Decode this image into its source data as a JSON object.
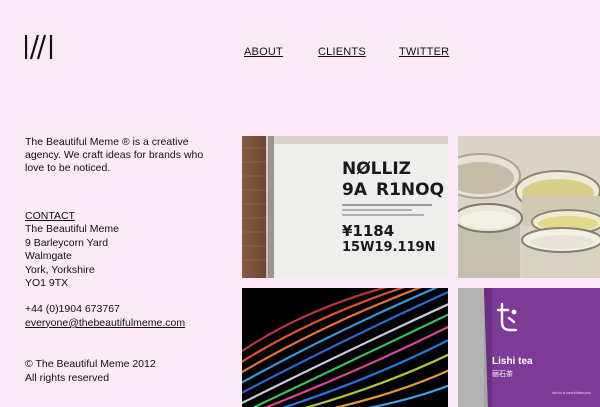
{
  "nav": {
    "about": "ABOUT",
    "clients": "CLIENTS",
    "twitter": "TWITTER"
  },
  "intro": {
    "text": "The Beautiful Meme ® is a creative agency. We craft ideas for brands who love to be noticed."
  },
  "contact": {
    "heading": "CONTACT",
    "address": [
      "The Beautiful Meme",
      "9 Barleycorn Yard",
      "Walmgate",
      "York, Yorkshire",
      "YO1 9TX"
    ],
    "phone": "+44 (0)1904 673767",
    "email": "everyone@thebeautifulmeme.com"
  },
  "footer": {
    "copyright": "© The Beautiful Meme 2012",
    "rights": "All rights reserved"
  },
  "tiles": {
    "typography": {
      "line1": "NØLLIZ",
      "line2a": "9A",
      "line2b": "R1NOQ",
      "line3": "¥1184",
      "line4": "15W19.119N"
    },
    "packaging": {
      "brand": "Lishi tea",
      "brand_cn": "丽石茶",
      "url": "visit us at www.lishitea.com"
    }
  },
  "colors": {
    "background": "#fdeaf7",
    "text": "#111111",
    "tea_purple": "#7e3a97"
  }
}
